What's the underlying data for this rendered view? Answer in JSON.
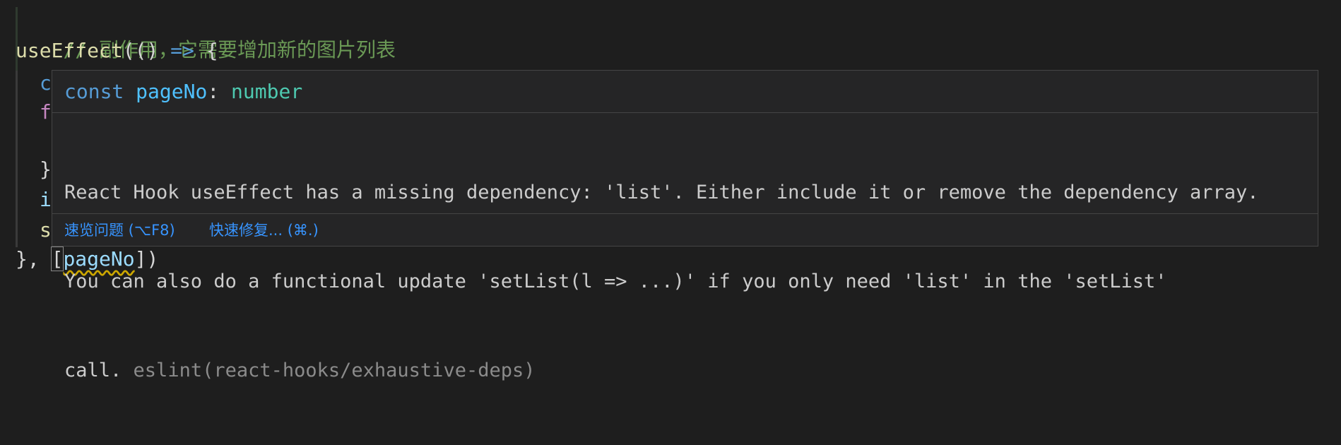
{
  "code": {
    "comment": "// 副作用，它需要增加新的图片列表",
    "line2": {
      "fn": "useEffect",
      "open": "(() ",
      "arrow": "=>",
      "brace": " {"
    },
    "visible_prefixes": [
      "c",
      "f",
      "",
      "}",
      "i",
      "s"
    ],
    "line_last": {
      "close": "}, ",
      "open_bracket": "[",
      "dep": "pageNo",
      "close_bracket": "])"
    }
  },
  "hover": {
    "signature": {
      "keyword": "const",
      "name": "pageNo",
      "colon": ":",
      "type": "number"
    },
    "message": {
      "line1": "React Hook useEffect has a missing dependency: 'list'. Either include it or remove the dependency array.",
      "line2": "You can also do a functional update 'setList(l => ...)' if you only need 'list' in the 'setList'",
      "line3": "call.",
      "source": "eslint(react-hooks/exhaustive-deps)"
    },
    "actions": {
      "peek": "速览问题 (⌥F8)",
      "quick_fix": "快速修复... (⌘.)"
    }
  },
  "colors": {
    "background": "#1e1e1e",
    "comment": "#6a9955",
    "function": "#dcdcaa",
    "keyword": "#569cd6",
    "type": "#4ec9b0",
    "link": "#3794ff",
    "warning_squiggle": "#cca700"
  }
}
